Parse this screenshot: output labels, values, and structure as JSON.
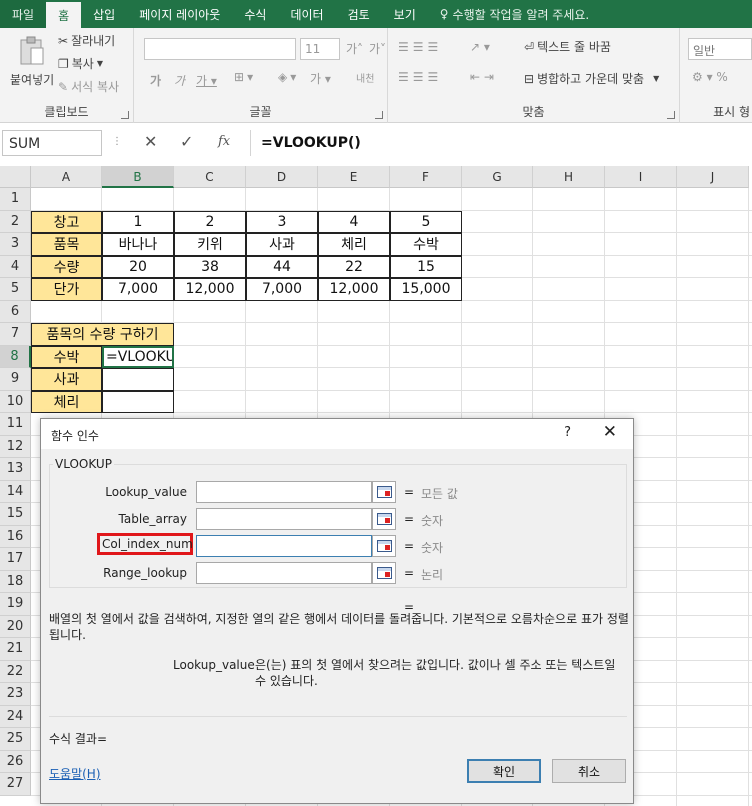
{
  "tabs": [
    "파일",
    "홈",
    "삽입",
    "페이지 레이아웃",
    "수식",
    "데이터",
    "검토",
    "보기"
  ],
  "tell_me": "수행할 작업을 알려 주세요.",
  "ribbon": {
    "paste": "붙여넣기",
    "cut": "잘라내기",
    "copy": "복사",
    "format_painter": "서식 복사",
    "clipboard_label": "클립보드",
    "font_size": "11",
    "font_label": "글꼴",
    "wrap_text": "텍스트 줄 바꿈",
    "merge_center": "병합하고 가운데 맞춤",
    "align_label": "맞춤",
    "number_format": "일반",
    "number_label": "표시 형"
  },
  "formula_bar": {
    "name_box": "SUM",
    "fx": "fx",
    "formula": "=VLOOKUP()"
  },
  "columns": [
    "A",
    "B",
    "C",
    "D",
    "E",
    "F",
    "G",
    "H",
    "I",
    "J"
  ],
  "rows": [
    "1",
    "2",
    "3",
    "4",
    "5",
    "6",
    "7",
    "8",
    "9",
    "10",
    "11",
    "12",
    "13",
    "14",
    "15",
    "16",
    "17",
    "18",
    "19",
    "20",
    "21",
    "22",
    "23",
    "24",
    "25",
    "26",
    "27"
  ],
  "table": {
    "r2": [
      "창고",
      "1",
      "2",
      "3",
      "4",
      "5"
    ],
    "r3": [
      "품목",
      "바나나",
      "키위",
      "사과",
      "체리",
      "수박"
    ],
    "r4": [
      "수량",
      "20",
      "38",
      "44",
      "22",
      "15"
    ],
    "r5": [
      "단가",
      "7,000",
      "12,000",
      "7,000",
      "12,000",
      "15,000"
    ]
  },
  "lookup": {
    "title": "품목의 수량 구하기",
    "items": [
      "수박",
      "사과",
      "체리"
    ],
    "b8": "=VLOOKUP()"
  },
  "dialog": {
    "title": "함수 인수",
    "help_q": "?",
    "close": "✕",
    "function": "VLOOKUP",
    "args": [
      {
        "label": "Lookup_value",
        "hint": "모든 값"
      },
      {
        "label": "Table_array",
        "hint": "숫자"
      },
      {
        "label": "Col_index_num",
        "hint": "숫자"
      },
      {
        "label": "Range_lookup",
        "hint": "논리"
      }
    ],
    "eq": "=",
    "description": "배열의 첫 열에서 값을 검색하여, 지정한 열의 같은 행에서 데이터를 돌려줍니다. 기본적으로 오름차순으로 표가 정렬됩니다.",
    "arg_name": "Lookup_value",
    "arg_desc": "은(는) 표의 첫 열에서 찾으려는 값입니다. 값이나 셀 주소 또는 텍스트일 수 있습니다.",
    "result": "수식 결과=",
    "help_link": "도움말(H)",
    "ok": "확인",
    "cancel": "취소"
  }
}
